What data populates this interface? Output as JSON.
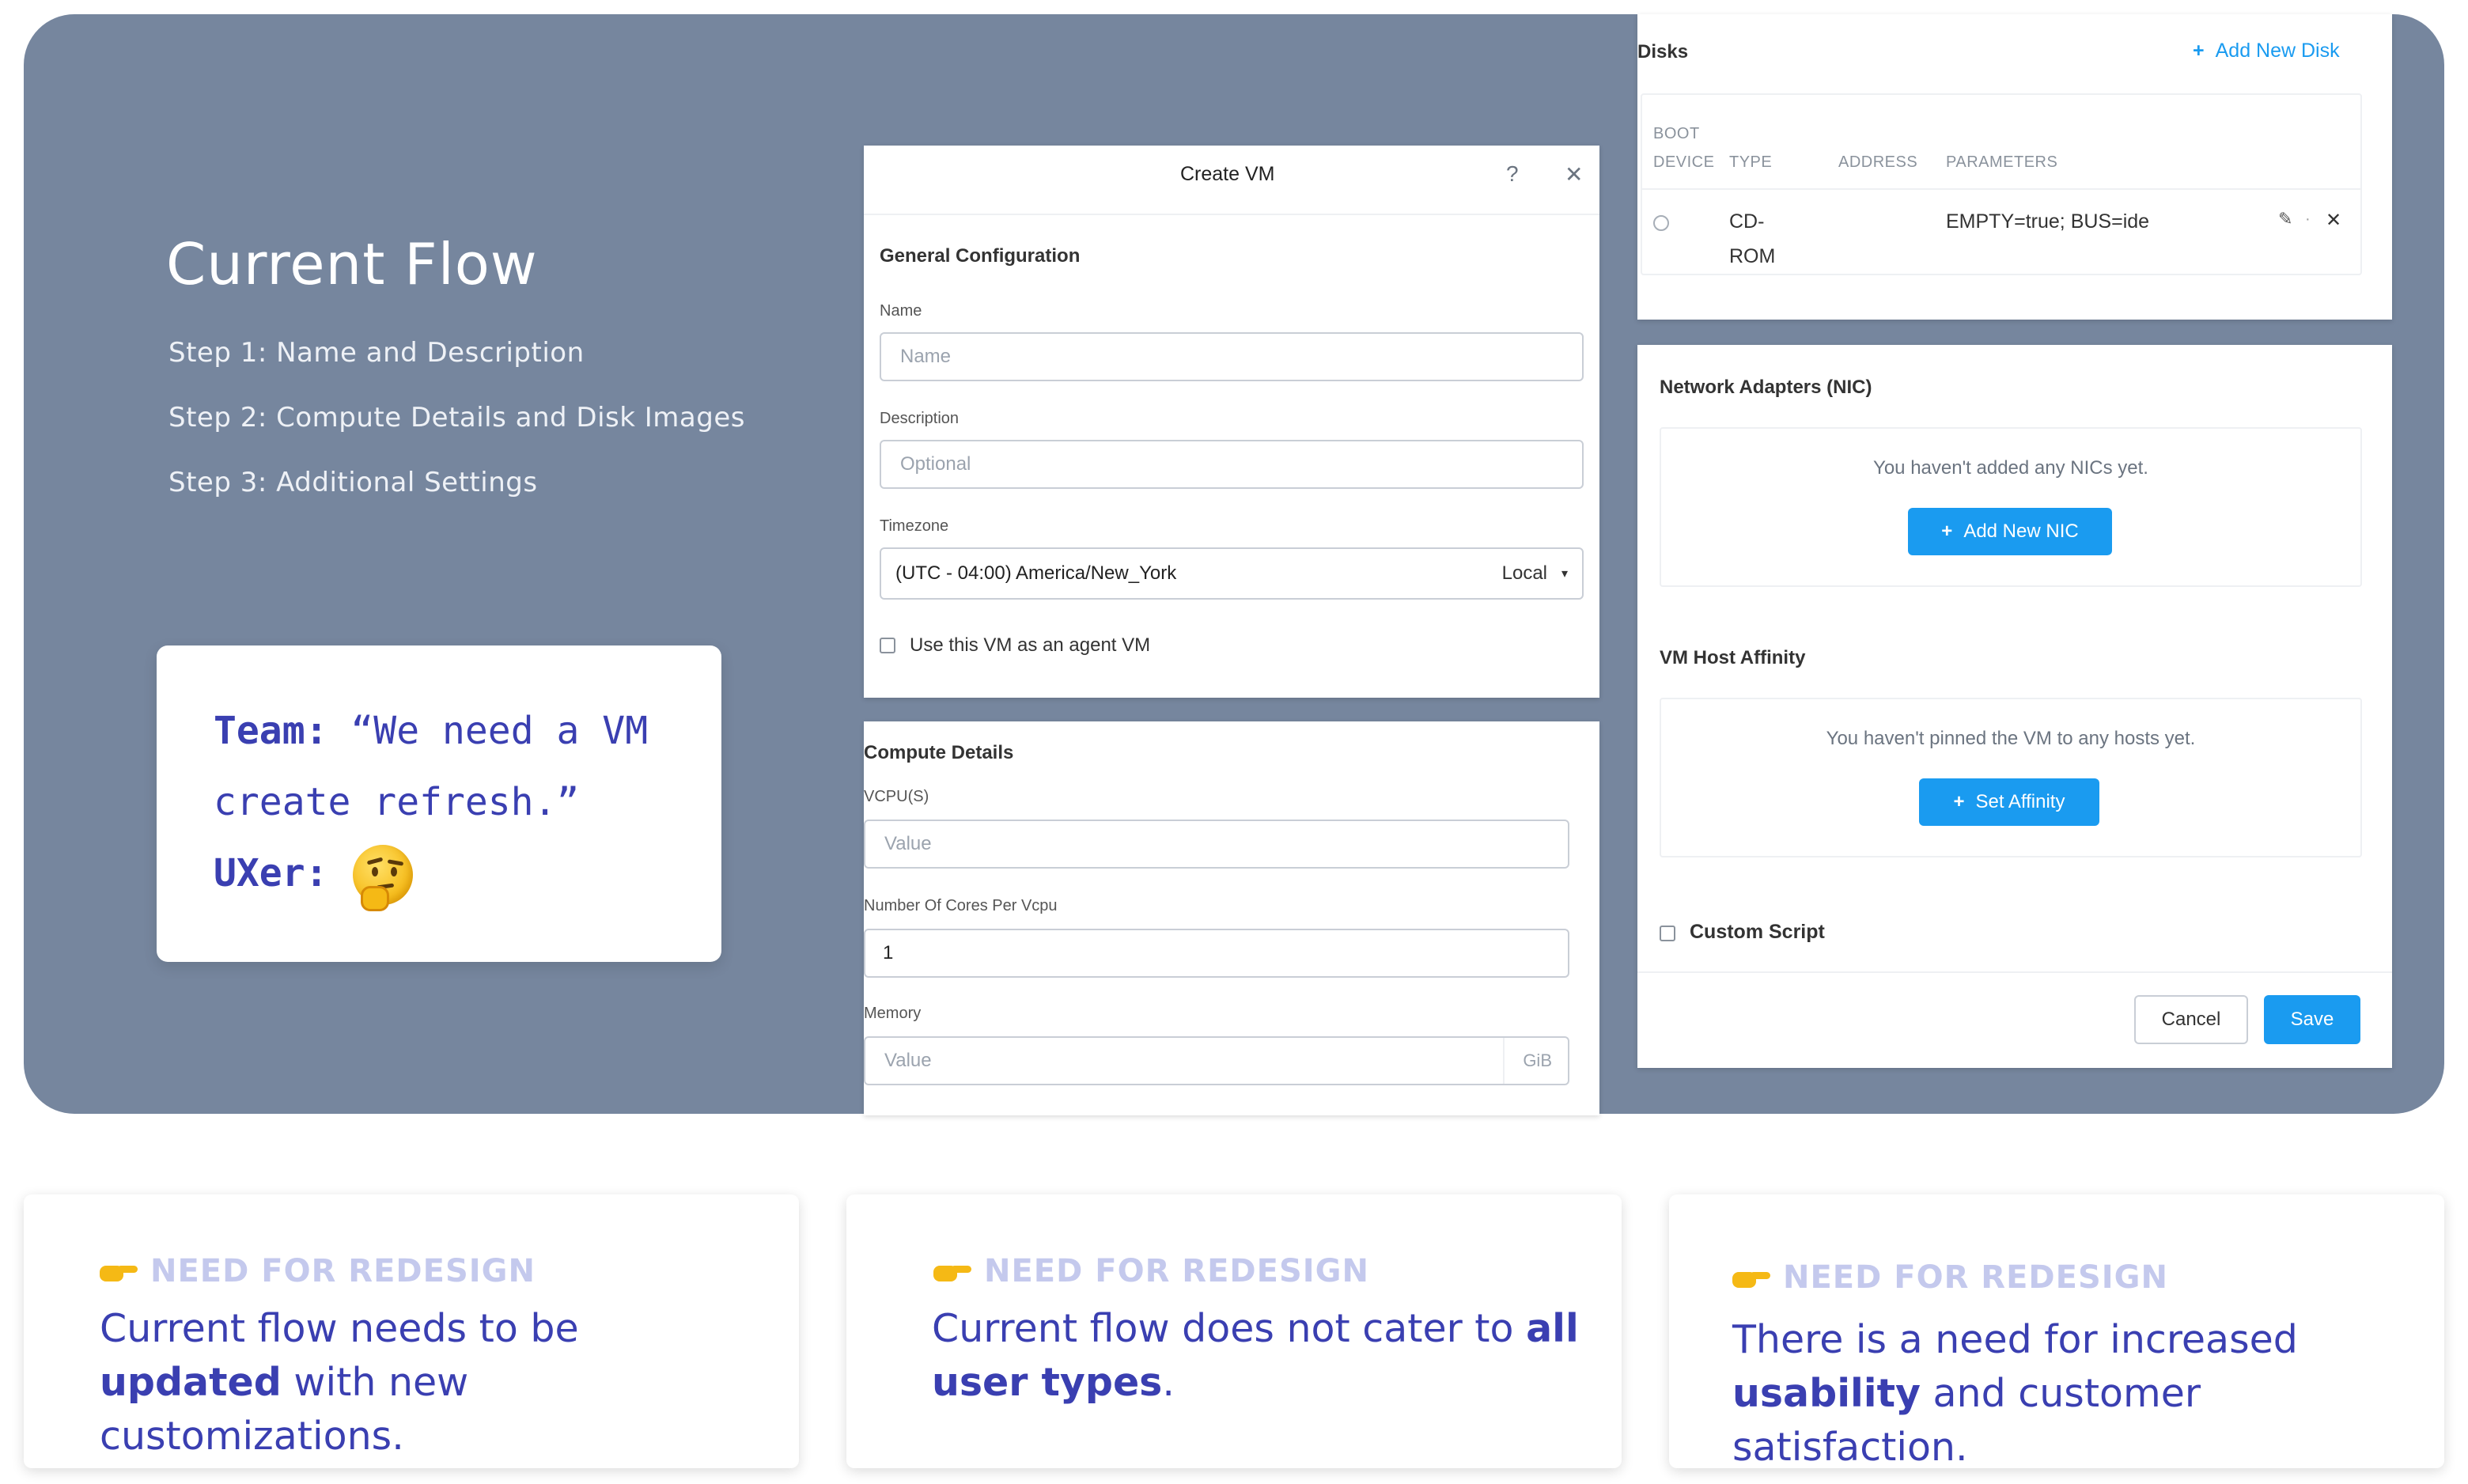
{
  "hero": {
    "title": "Current Flow",
    "steps": [
      "Step 1: Name and Description",
      "Step 2: Compute Details and Disk Images",
      "Step 3: Additional Settings"
    ]
  },
  "quote": {
    "team_label": "Team:",
    "team_text_1": "“We need a VM",
    "team_text_2": "create refresh.”",
    "uxer_label": "UXer:",
    "uxer_emoji": "thinking-face-emoji"
  },
  "create_vm": {
    "title": "Create VM",
    "help": "?",
    "close": "✕",
    "section": "General Configuration",
    "name_label": "Name",
    "name_placeholder": "Name",
    "description_label": "Description",
    "description_placeholder": "Optional",
    "timezone_label": "Timezone",
    "timezone_value": "(UTC - 04:00) America/New_York",
    "timezone_mode": "Local",
    "agent_checkbox_label": "Use this VM as an agent VM"
  },
  "compute": {
    "section": "Compute Details",
    "vcpu_label": "VCPU(S)",
    "vcpu_placeholder": "Value",
    "cores_label": "Number Of Cores Per Vcpu",
    "cores_value": "1",
    "memory_label": "Memory",
    "memory_placeholder": "Value",
    "memory_unit": "GiB"
  },
  "disks": {
    "title": "Disks",
    "add_label": "Add New Disk",
    "columns": [
      "BOOT",
      "DEVICE",
      "TYPE",
      "ADDRESS",
      "PARAMETERS"
    ],
    "row": {
      "type_1": "CD-",
      "type_2": "ROM",
      "parameters": "EMPTY=true; BUS=ide"
    }
  },
  "nic": {
    "title": "Network Adapters (NIC)",
    "empty_text": "You haven't added any NICs yet.",
    "add_label": "Add New NIC"
  },
  "affinity": {
    "title": "VM Host Affinity",
    "empty_text": "You haven't pinned the VM to any hosts yet.",
    "set_label": "Set Affinity"
  },
  "custom_script": {
    "label": "Custom Script"
  },
  "footer": {
    "cancel": "Cancel",
    "save": "Save"
  },
  "cards": [
    {
      "kicker": "NEED FOR REDESIGN",
      "pre": "Current flow needs to be ",
      "bold": "updated",
      "post": " with new customizations."
    },
    {
      "kicker": "NEED FOR REDESIGN",
      "pre": "Current flow does not cater to ",
      "bold": "all user types",
      "post": "."
    },
    {
      "kicker": "NEED FOR REDESIGN",
      "pre": "There is a need for increased ",
      "bold": "usability",
      "post": " and customer satisfaction."
    }
  ],
  "colors": {
    "hero_bg": "#76869e",
    "accent_blue": "#1a9bf0",
    "indigo_text": "#3a3fb1",
    "kicker": "#c4c9ed"
  }
}
